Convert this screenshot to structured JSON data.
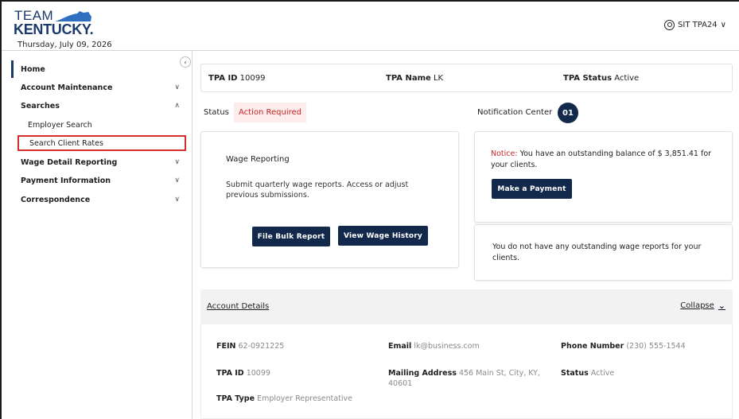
{
  "header": {
    "logo_top": "TEAM",
    "logo_bottom": "KENTUCKY.",
    "date": "Thursday, July 09, 2026",
    "user": "SIT TPA24",
    "user_chevron": "∨"
  },
  "sidebar": {
    "collapse_glyph": "‹",
    "items": [
      {
        "label": "Home",
        "chevron": ""
      },
      {
        "label": "Account Maintenance",
        "chevron": "∨"
      },
      {
        "label": "Searches",
        "chevron": "∧"
      },
      {
        "label": "Employer Search"
      },
      {
        "label": "Search Client Rates"
      },
      {
        "label": "Wage Detail Reporting",
        "chevron": "∨"
      },
      {
        "label": "Payment Information",
        "chevron": "∨"
      },
      {
        "label": "Correspondence",
        "chevron": "∨"
      }
    ]
  },
  "infobar": {
    "tpa_id_label": "TPA ID",
    "tpa_id": "10099",
    "tpa_name_label": "TPA Name",
    "tpa_name": "LK",
    "tpa_status_label": "TPA Status",
    "tpa_status": "Active"
  },
  "status": {
    "label": "Status",
    "badge": "Action Required"
  },
  "notifications": {
    "label": "Notification Center",
    "count": "01"
  },
  "wage": {
    "title": "Wage Reporting",
    "description": "Submit quarterly wage reports. Access or adjust previous submissions.",
    "file_bulk": "File Bulk Report",
    "view_history": "View Wage History"
  },
  "notice1": {
    "prefix": "Notice:",
    "text": " You have an outstanding balance of $ 3,851.41 for your clients.",
    "button": "Make a Payment"
  },
  "notice2": {
    "text": "You do not have any outstanding wage reports for your clients."
  },
  "account": {
    "title": "Account Details",
    "collapse": "Collapse",
    "collapse_glyph": "⌄",
    "fein_label": "FEIN",
    "fein": "62-0921225",
    "email_label": "Email",
    "email": "lk@business.com",
    "phone_label": "Phone Number",
    "phone": "(230) 555-1544",
    "tpa_id_label": "TPA ID",
    "tpa_id": "10099",
    "mailing_label": "Mailing Address",
    "mailing": "456 Main St, City, KY, 40601",
    "status_label": "Status",
    "status": "Active",
    "tpa_type_label": "TPA Type",
    "tpa_type": "Employer Representative"
  },
  "colors": {
    "navy": "#13294b",
    "alert_red": "#c62828",
    "alert_bg": "#fdecec",
    "highlight_border": "#d32f2f"
  }
}
